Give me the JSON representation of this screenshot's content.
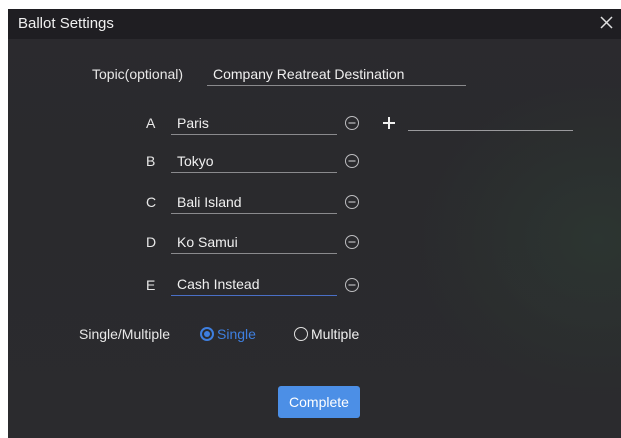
{
  "window": {
    "title": "Ballot Settings"
  },
  "topic": {
    "label": "Topic(optional)",
    "value": "Company Reatreat Destination"
  },
  "options": [
    {
      "letter": "A",
      "value": "Paris"
    },
    {
      "letter": "B",
      "value": "Tokyo"
    },
    {
      "letter": "C",
      "value": "Bali Island"
    },
    {
      "letter": "D",
      "value": "Ko Samui"
    },
    {
      "letter": "E",
      "value": "Cash Instead"
    }
  ],
  "new_option": {
    "value": ""
  },
  "mode": {
    "label": "Single/Multiple",
    "single_label": "Single",
    "multiple_label": "Multiple",
    "selected": "Single"
  },
  "actions": {
    "complete_label": "Complete"
  },
  "colors": {
    "accent": "#3e7fe0",
    "button": "#4c8fe6",
    "background": "#2b2a2e",
    "titlebar": "#1f1e22"
  },
  "icons": {
    "close": "close-icon",
    "remove": "minus-circle-icon",
    "add": "plus-icon"
  }
}
